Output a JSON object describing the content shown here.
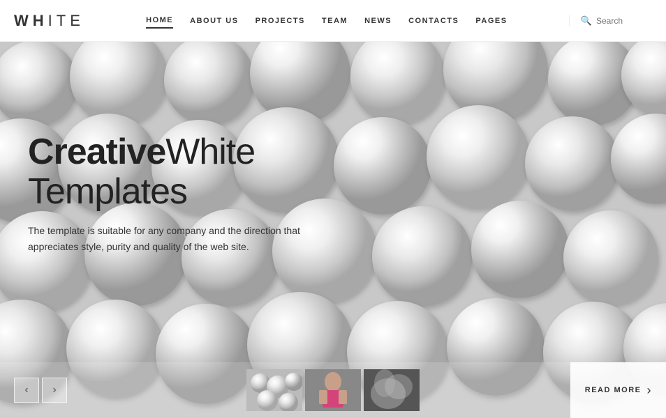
{
  "header": {
    "logo": {
      "bold": "WH",
      "light": "ITE"
    },
    "nav": {
      "items": [
        {
          "label": "HOME",
          "active": true
        },
        {
          "label": "ABOUT US",
          "active": false
        },
        {
          "label": "PROJECTS",
          "active": false
        },
        {
          "label": "TEAM",
          "active": false
        },
        {
          "label": "NEWS",
          "active": false
        },
        {
          "label": "CONTACTS",
          "active": false
        },
        {
          "label": "PAGES",
          "active": false
        }
      ]
    },
    "search": {
      "placeholder": "Search"
    }
  },
  "hero": {
    "title_bold": "Creative",
    "title_light": "White Templates",
    "subtitle": "The template is suitable for any company and the direction that appreciates style, purity and quality of the web site."
  },
  "bottom": {
    "prev_arrow": "‹",
    "next_arrow": "›",
    "read_more": "READ MORE",
    "arrow": "›"
  }
}
